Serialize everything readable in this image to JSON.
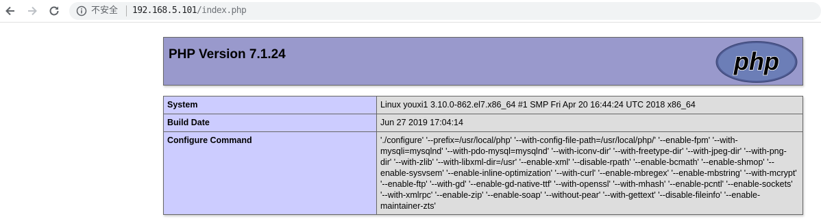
{
  "browser": {
    "security_label": "不安全",
    "url_host": "192.168.5.101",
    "url_path": "/index.php",
    "icons": [
      "back-arrow-icon",
      "forward-arrow-icon",
      "reload-icon",
      "info-icon"
    ]
  },
  "header": {
    "title": "PHP Version 7.1.24",
    "logo_text": "php"
  },
  "table": {
    "rows": [
      {
        "key": "System",
        "value": "Linux youxi1 3.10.0-862.el7.x86_64 #1 SMP Fri Apr 20 16:44:24 UTC 2018 x86_64"
      },
      {
        "key": "Build Date",
        "value": "Jun 27 2019 17:04:14"
      },
      {
        "key": "Configure Command",
        "value": "'./configure' '--prefix=/usr/local/php' '--with-config-file-path=/usr/local/php/' '--enable-fpm' '--with-mysqli=mysqlnd' '--with-pdo-mysql=mysqlnd' '--with-iconv-dir' '--with-freetype-dir' '--with-jpeg-dir' '--with-png-dir' '--with-zlib' '--with-libxml-dir=/usr' '--enable-xml' '--disable-rpath' '--enable-bcmath' '--enable-shmop' '--enable-sysvsem' '--enable-inline-optimization' '--with-curl' '--enable-mbregex' '--enable-mbstring' '--with-mcrypt' '--enable-ftp' '--with-gd' '--enable-gd-native-ttf' '--with-openssl' '--with-mhash' '--enable-pcntl' '--enable-sockets' '--with-xmlrpc' '--enable-zip' '--enable-soap' '--without-pear' '--with-gettext' '--disable-fileinfo' '--enable-maintainer-zts'"
      }
    ]
  },
  "colors": {
    "header_bg": "#9999cc",
    "key_bg": "#ccccff",
    "value_bg": "#dddddd",
    "logo_bg": "#6c7eb7"
  }
}
